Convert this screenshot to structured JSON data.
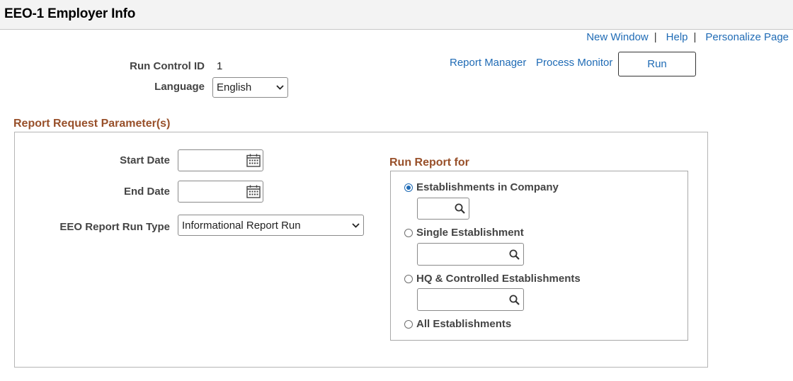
{
  "header": {
    "title": "EEO-1 Employer Info"
  },
  "toplinks": {
    "new_window": "New Window",
    "help": "Help",
    "personalize": "Personalize Page",
    "separator": "|"
  },
  "run_control": {
    "id_label": "Run Control ID",
    "id_value": "1",
    "language_label": "Language",
    "language_value": "English"
  },
  "actions": {
    "report_manager": "Report Manager",
    "process_monitor": "Process Monitor",
    "run": "Run"
  },
  "params": {
    "title": "Report Request Parameter(s)",
    "start_date_label": "Start Date",
    "start_date_value": "",
    "end_date_label": "End Date",
    "end_date_value": "",
    "run_type_label": "EEO Report Run Type",
    "run_type_value": "Informational Report Run"
  },
  "run_for": {
    "title": "Run Report for",
    "options": [
      {
        "label": "Establishments in Company",
        "selected": true
      },
      {
        "label": "Single Establishment",
        "selected": false
      },
      {
        "label": "HQ & Controlled Establishments",
        "selected": false
      },
      {
        "label": "All Establishments",
        "selected": false
      }
    ]
  },
  "colors": {
    "link": "#1f6bb5",
    "section_title": "#98502a",
    "header_bg": "#f3f3f3"
  }
}
